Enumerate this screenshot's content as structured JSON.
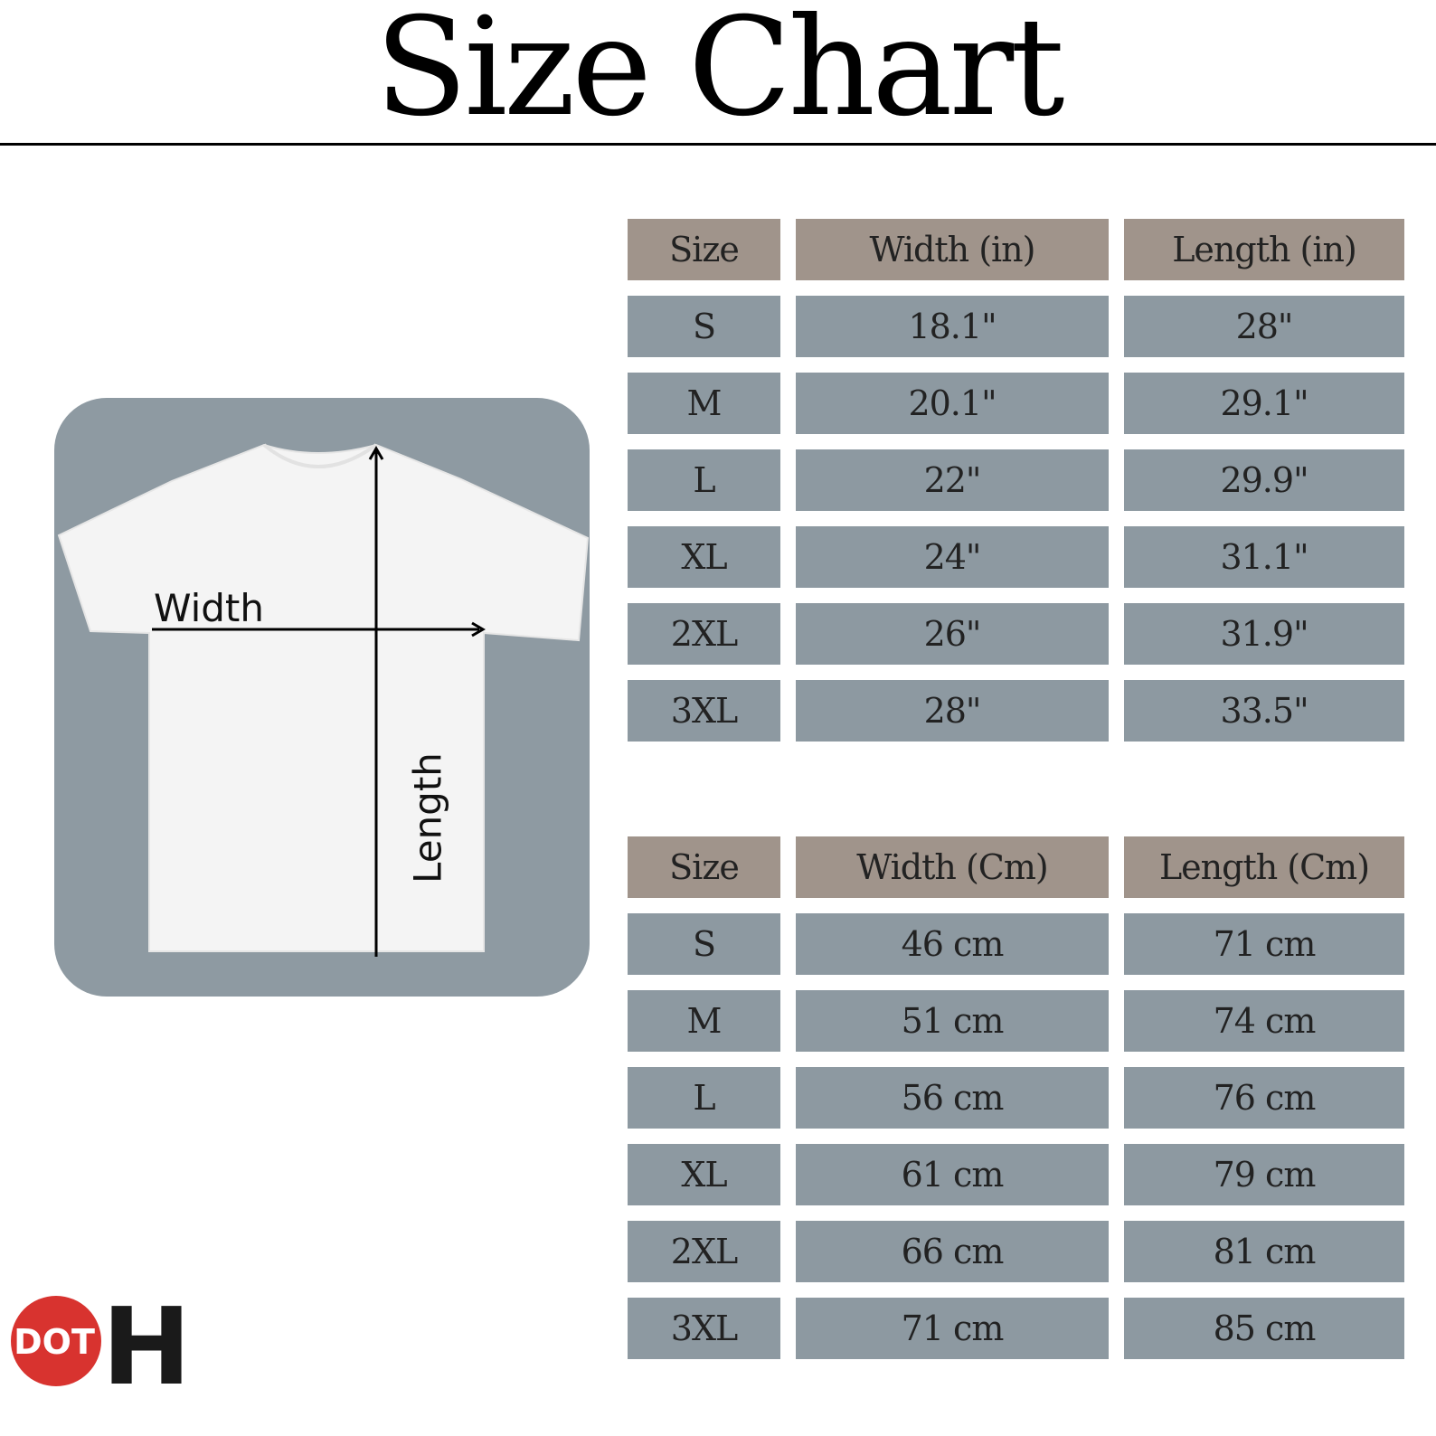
{
  "title": "Size Chart",
  "diagram": {
    "width_label": "Width",
    "length_label": "Length",
    "panel_color": "#8e9aa2"
  },
  "table_inches": {
    "headers": [
      "Size",
      "Width (in)",
      "Length (in)"
    ],
    "rows": [
      [
        "S",
        "18.1\"",
        "28\""
      ],
      [
        "M",
        "20.1\"",
        "29.1\""
      ],
      [
        "L",
        "22\"",
        "29.9\""
      ],
      [
        "XL",
        "24\"",
        "31.1\""
      ],
      [
        "2XL",
        "26\"",
        "31.9\""
      ],
      [
        "3XL",
        "28\"",
        "33.5\""
      ]
    ]
  },
  "table_cm": {
    "headers": [
      "Size",
      "Width (Cm)",
      "Length (Cm)"
    ],
    "rows": [
      [
        "S",
        "46 cm",
        "71 cm"
      ],
      [
        "M",
        "51 cm",
        "74 cm"
      ],
      [
        "L",
        "56 cm",
        "76 cm"
      ],
      [
        "XL",
        "61 cm",
        "79 cm"
      ],
      [
        "2XL",
        "66 cm",
        "81 cm"
      ],
      [
        "3XL",
        "71 cm",
        "85 cm"
      ]
    ]
  },
  "logo": {
    "text": "DOT",
    "letter": "H",
    "circle_color": "#d8332f"
  },
  "colors": {
    "header_cell": "#a0948b",
    "body_cell": "#8d99a1"
  }
}
